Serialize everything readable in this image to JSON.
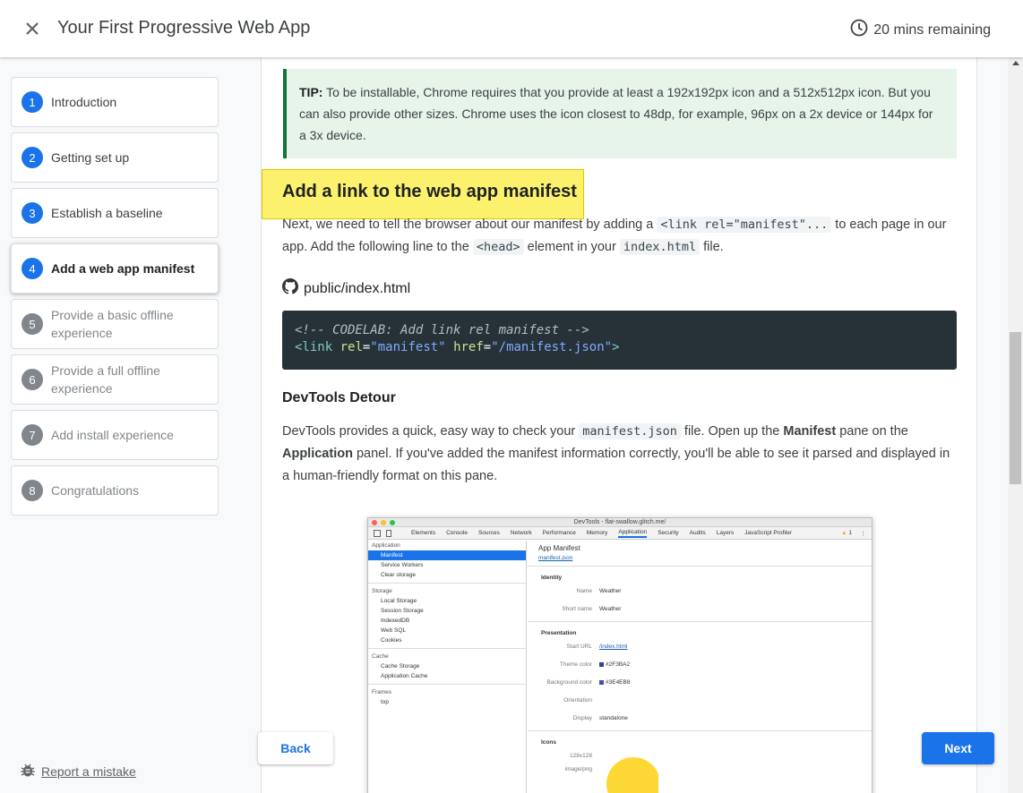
{
  "header": {
    "title": "Your First Progressive Web App",
    "time_remaining": "20 mins remaining"
  },
  "sidebar": {
    "steps": [
      {
        "num": "1",
        "label": "Introduction",
        "state": "done"
      },
      {
        "num": "2",
        "label": "Getting set up",
        "state": "done"
      },
      {
        "num": "3",
        "label": "Establish a baseline",
        "state": "done"
      },
      {
        "num": "4",
        "label": "Add a web app manifest",
        "state": "active"
      },
      {
        "num": "5",
        "label": "Provide a basic offline experience",
        "state": "todo"
      },
      {
        "num": "6",
        "label": "Provide a full offline experience",
        "state": "todo"
      },
      {
        "num": "7",
        "label": "Add install experience",
        "state": "todo"
      },
      {
        "num": "8",
        "label": "Congratulations",
        "state": "todo"
      }
    ],
    "report_label": "Report a mistake"
  },
  "content": {
    "tip_label": "TIP:",
    "tip_text": "To be installable, Chrome requires that you provide at least a 192x192px icon and a 512x512px icon. But you can also provide other sizes. Chrome uses the icon closest to 48dp, for example, 96px on a 2x device or 144px for a 3x device.",
    "heading": "Add a link to the web app manifest",
    "para1_a": "Next, we need to tell the browser about our manifest by adding a ",
    "para1_code1": "<link rel=\"manifest\"...",
    "para1_b": " to each page in our app. Add the following line to the ",
    "para1_code2": "<head>",
    "para1_c": " element in your ",
    "para1_code3": "index.html",
    "para1_d": " file.",
    "file_name": "public/index.html",
    "code_comment": "<!-- CODELAB: Add link rel manifest -->",
    "code_tag_open": "<link",
    "code_attr1": "rel",
    "code_val1": "\"manifest\"",
    "code_attr2": "href",
    "code_val2": "\"/manifest.json\"",
    "code_tag_close": ">",
    "subheading": "DevTools Detour",
    "para2_a": "DevTools provides a quick, easy way to check your ",
    "para2_code": "manifest.json",
    "para2_b": " file. Open up the ",
    "para2_bold1": "Manifest",
    "para2_c": " pane on the ",
    "para2_bold2": "Application",
    "para2_d": " panel. If you've added the manifest information correctly, you'll be able to see it parsed and displayed in a human-friendly format on this pane."
  },
  "devtools": {
    "window_title": "DevTools - flat-swallow.glitch.me/",
    "tabs": [
      "Elements",
      "Console",
      "Sources",
      "Network",
      "Performance",
      "Memory",
      "Application",
      "Security",
      "Audits",
      "Layers",
      "JavaScript Profiler"
    ],
    "selected_tab": "Application",
    "warning_count": "1",
    "sidebar": {
      "application_header": "Application",
      "application_items": [
        "Manifest",
        "Service Workers",
        "Clear storage"
      ],
      "storage_header": "Storage",
      "storage_items": [
        "Local Storage",
        "Session Storage",
        "IndexedDB",
        "Web SQL",
        "Cookies"
      ],
      "cache_header": "Cache",
      "cache_items": [
        "Cache Storage",
        "Application Cache"
      ],
      "frames_header": "Frames",
      "frames_items": [
        "top"
      ]
    },
    "manifest": {
      "title": "App Manifest",
      "link": "manifest.json",
      "identity_header": "Identity",
      "name_label": "Name",
      "name_value": "Weather",
      "short_name_label": "Short name",
      "short_name_value": "Weather",
      "presentation_header": "Presentation",
      "start_url_label": "Start URL",
      "start_url_value": "/index.html",
      "theme_color_label": "Theme color",
      "theme_color_value": "#2F3BA2",
      "bg_color_label": "Background color",
      "bg_color_value": "#3E4EB8",
      "orientation_label": "Orientation",
      "orientation_value": "",
      "display_label": "Display",
      "display_value": "standalone",
      "icons_header": "Icons",
      "icon_size": "128x128",
      "icon_type": "image/png"
    }
  },
  "nav": {
    "back_label": "Back",
    "next_label": "Next"
  },
  "colors": {
    "accent": "#1a73e8",
    "tip_bg": "#e6f4ea",
    "tip_border": "#137333",
    "highlight": "#fbf16c",
    "code_bg": "#263238"
  },
  "icons": {
    "close": "close-icon",
    "clock": "clock-icon",
    "github": "github-icon",
    "bug": "bug-icon"
  }
}
